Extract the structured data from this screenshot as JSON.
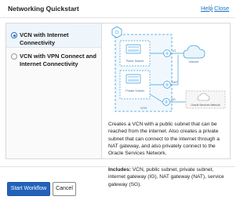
{
  "dialog": {
    "title": "Networking Quickstart",
    "help_label": "Help",
    "close_label": "Close"
  },
  "options": [
    {
      "label": "VCN with Internet Connectivity",
      "selected": true
    },
    {
      "label": "VCN with VPN Connect and Internet Connectivity",
      "selected": false
    }
  ],
  "diagram": {
    "public_subnet": "Public Subnet",
    "private_subnet": "Private Subnet",
    "vcn": "VCN",
    "igw": "IG",
    "nat": "NAT",
    "sgw": "SG",
    "internet": "Internet",
    "oracle_services": "Oracle Services Network",
    "accent_color": "#3a9bd9"
  },
  "description": "Creates a VCN with a public subnet that can be reached from the internet. Also creates a private subnet that can connect to the internet through a NAT gateway, and also privately connect to the Oracle Services Network.",
  "includes": {
    "label": "Includes:",
    "text": " VCN, public subnet, private subnet, internet gateway (IG), NAT gateway (NAT), service gateway (SG)."
  },
  "buttons": {
    "primary": "Start Workflow",
    "secondary": "Cancel"
  }
}
